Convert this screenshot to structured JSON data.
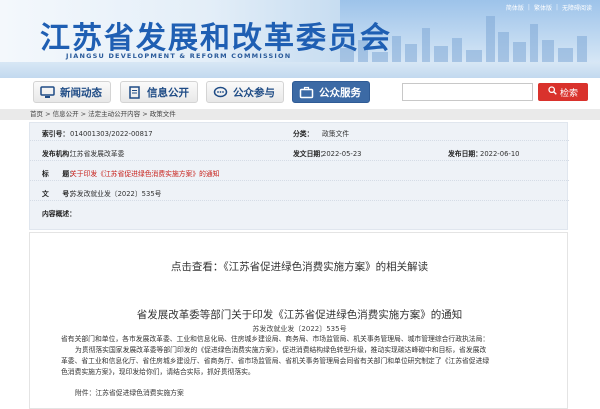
{
  "header": {
    "title": "江苏省发展和改革委员会",
    "subtitle": "JIANGSU DEVELOPMENT & REFORM COMMISSION",
    "top_links": [
      "简体版",
      "繁体版",
      "无障碍阅读"
    ]
  },
  "nav": {
    "items": [
      {
        "label": "新闻动态",
        "icon": "monitor-icon"
      },
      {
        "label": "信息公开",
        "icon": "document-icon"
      },
      {
        "label": "公众参与",
        "icon": "chat-icon"
      },
      {
        "label": "公众服务",
        "icon": "briefcase-icon"
      }
    ],
    "search_placeholder": "",
    "search_button": "检索"
  },
  "breadcrumb": "首页 > 信息公开 > 法定主动公开内容 > 政策文件",
  "info": {
    "index_label": "索引号：",
    "index_value": "014001303/2022-00817",
    "category_label": "分类：",
    "category_value": "政策文件",
    "org_label": "发布机构：",
    "org_value": "江苏省发展改革委",
    "pub_date_label": "发文日期：",
    "pub_date_value": "2022-05-23",
    "release_date_label": "发布日期：",
    "release_date_value": "2022-06-10",
    "title_label": "标　　题：",
    "title_value": "关于印发《江苏省促进绿色消费实施方案》的通知",
    "doc_label": "文　　号：",
    "doc_value": "苏发改就业发〔2022〕535号",
    "summary_label": "内容概述："
  },
  "article": {
    "view_link": "点击查看：《江苏省促进绿色消费实施方案》的相关解读",
    "title": "省发展改革委等部门关于印发《江苏省促进绿色消费实施方案》的通知",
    "doc_number": "苏发改就业发〔2022〕535号",
    "lines": [
      "省有关部门和单位，各市发展改革委、工业和信息化局、住房城乡建设局、商务局、市场监管局、机关事务管理局、城市管理综合行政执法局：",
      "为贯彻落实国家发展改革委等部门印发的《促进绿色消费实施方案》，促进消费结构绿色转型升级，推动实现碳达峰碳中和目标，省发展改",
      "革委、省工业和信息化厅、省住房城乡建设厅、省商务厅、省市场监管局、省机关事务管理局会同省有关部门和单位研究制定了《江苏省促进绿",
      "色消费实施方案》，现印发给你们，请结合实际，抓好贯彻落实。",
      "附件：江苏省促进绿色消费实施方案"
    ]
  }
}
